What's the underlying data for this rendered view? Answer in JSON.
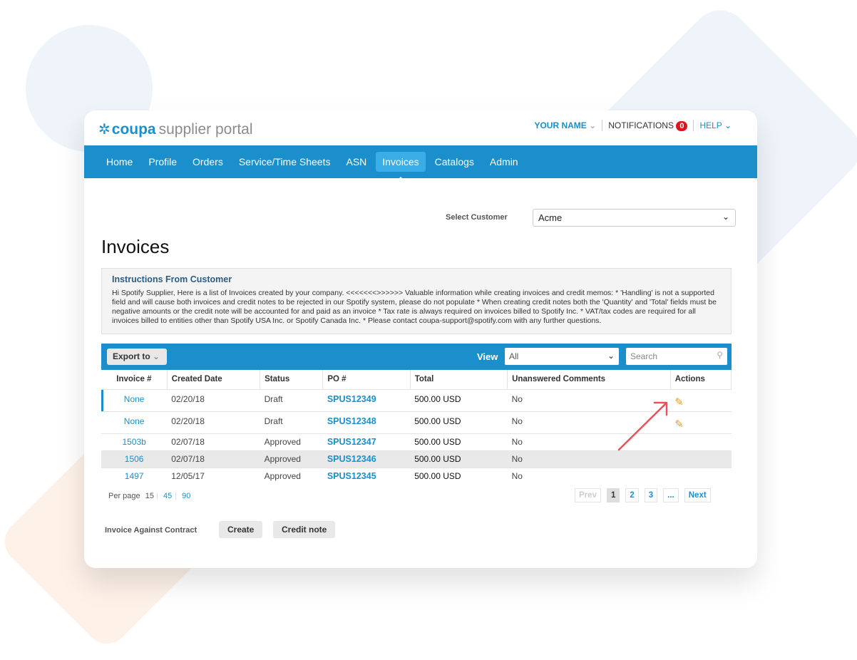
{
  "logo": {
    "brand": "coupa",
    "suffix": "supplier portal"
  },
  "header": {
    "user": "YOUR NAME",
    "notifications": "NOTIFICATIONS",
    "notif_count": "0",
    "help": "HELP"
  },
  "nav": [
    "Home",
    "Profile",
    "Orders",
    "Service/Time Sheets",
    "ASN",
    "Invoices",
    "Catalogs",
    "Admin"
  ],
  "nav_active": "Invoices",
  "customer": {
    "label": "Select Customer",
    "value": "Acme"
  },
  "title": "Invoices",
  "instructions": {
    "heading": "Instructions From Customer",
    "text": "Hi Spotify Supplier, Here is a list of Invoices created by your company. <<<<<<<>>>>>> Valuable information while creating invoices and credit memos: * 'Handling' is not a supported field and will cause both invoices and credit notes to be rejected in our Spotify system, please do not populate * When creating credit notes both the 'Quantity' and 'Total' fields must be negative amounts or the credit note will be accounted for and paid as an invoice * Tax rate is always required on invoices billed to Spotify Inc. * VAT/tax codes are required for all invoices billed to entities other than Spotify USA Inc. or Spotify Canada Inc. * Please contact coupa-support@spotify.com with any further questions."
  },
  "toolbar": {
    "export": "Export to",
    "view_label": "View",
    "view_value": "All",
    "search_placeholder": "Search"
  },
  "table": {
    "columns": [
      "Invoice #",
      "Created Date",
      "Status",
      "PO #",
      "Total",
      "Unanswered Comments",
      "Actions"
    ],
    "rows": [
      {
        "invoice": "None",
        "date": "02/20/18",
        "status": "Draft",
        "po": "SPUS12349",
        "total": "500.00 USD",
        "comments": "No",
        "editable": true
      },
      {
        "invoice": "None",
        "date": "02/20/18",
        "status": "Draft",
        "po": "SPUS12348",
        "total": "500.00 USD",
        "comments": "No",
        "editable": true
      },
      {
        "invoice": "1503b",
        "date": "02/07/18",
        "status": "Approved",
        "po": "SPUS12347",
        "total": "500.00 USD",
        "comments": "No",
        "editable": false
      },
      {
        "invoice": "1506",
        "date": "02/07/18",
        "status": "Approved",
        "po": "SPUS12346",
        "total": "500.00 USD",
        "comments": "No",
        "editable": false
      },
      {
        "invoice": "1497",
        "date": "12/05/17",
        "status": "Approved",
        "po": "SPUS12345",
        "total": "500.00 USD",
        "comments": "No",
        "editable": false
      }
    ]
  },
  "perpage": {
    "label": "Per page",
    "current": "15",
    "options": [
      "45",
      "90"
    ]
  },
  "pager": {
    "prev": "Prev",
    "pages": [
      "1",
      "2",
      "3",
      "..."
    ],
    "current": "1",
    "next": "Next"
  },
  "footer": {
    "label": "Invoice Against Contract",
    "create": "Create",
    "credit": "Credit note"
  },
  "colors": {
    "brand": "#1a8fcb",
    "badge": "#e0131b",
    "arrow": "#e8505b",
    "pencil": "#e39a2d"
  }
}
